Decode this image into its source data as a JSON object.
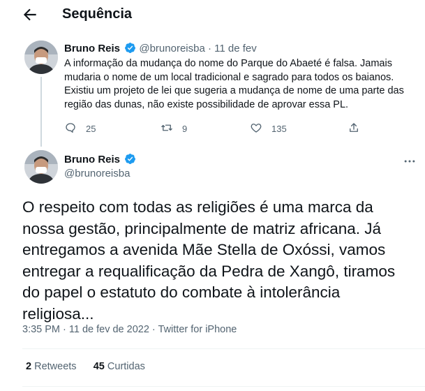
{
  "header": {
    "title": "Sequência"
  },
  "reply_tweet": {
    "author_name": "Bruno Reis",
    "handle": "@brunoreisba",
    "separator": "·",
    "date": "11 de fev",
    "text": "A informação da mudança do nome do Parque do Abaeté é falsa. Jamais mudaria o nome de um local tradicional e sagrado para todos os baianos. Existiu um projeto de lei que sugeria a mudança de nome de uma parte das região das dunas, não existe possibilidade de aprovar essa PL.",
    "replies": "25",
    "retweets": "9",
    "likes": "135"
  },
  "main_tweet": {
    "author_name": "Bruno Reis",
    "handle": "@brunoreisba",
    "text": "O respeito com todas as religiões é uma marca da nossa gestão, principalmente de matriz africana. Já entregamos a avenida Mãe Stella de Oxóssi, vamos entregar a requalificação da Pedra de Xangô, tiramos do papel o estatuto do combate à intolerância religiosa...",
    "timestamp": "3:35 PM · 11 de fev de 2022 · Twitter for iPhone",
    "retweet_count": "2",
    "retweet_label": "Retweets",
    "like_count": "45",
    "like_label": "Curtidas"
  },
  "colors": {
    "text": "#0f1419",
    "muted": "#536471",
    "verified": "#1d9bf0",
    "divider": "#eff3f4"
  },
  "icons": [
    "back-arrow-icon",
    "verified-badge-icon",
    "reply-icon",
    "retweet-icon",
    "like-icon",
    "share-icon",
    "more-icon"
  ]
}
